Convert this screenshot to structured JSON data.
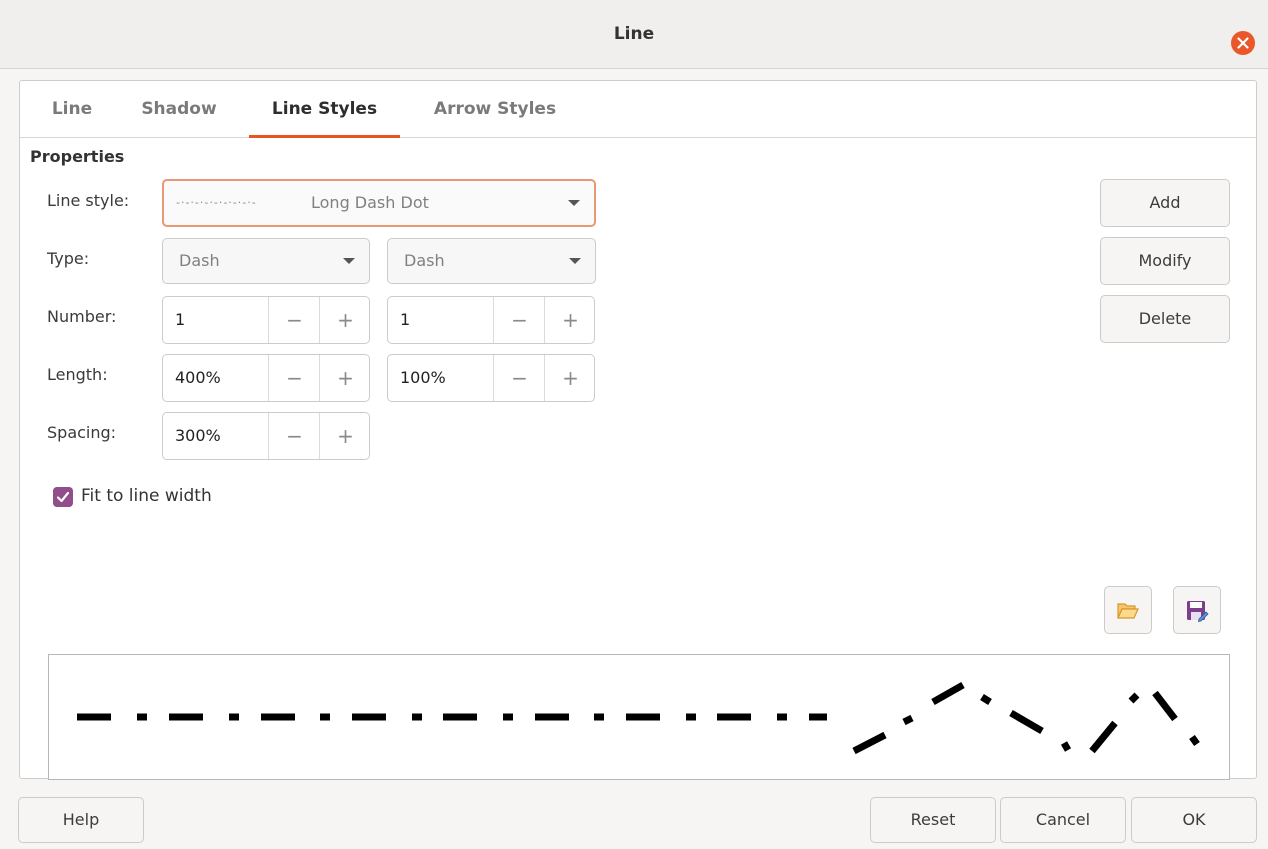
{
  "window": {
    "title": "Line"
  },
  "tabs": [
    {
      "label": "Line"
    },
    {
      "label": "Shadow"
    },
    {
      "label": "Line Styles"
    },
    {
      "label": "Arrow Styles"
    }
  ],
  "properties": {
    "heading": "Properties",
    "line_style_label": "Line style:",
    "line_style_sample": "-·-·-·-·-·-·-·-·-",
    "line_style_value": "Long Dash Dot",
    "type_label": "Type:",
    "type1": "Dash",
    "type2": "Dash",
    "number_label": "Number:",
    "number1": "1",
    "number2": "1",
    "length_label": "Length:",
    "length1": "400%",
    "length2": "100%",
    "spacing_label": "Spacing:",
    "spacing": "300%",
    "fit_label": "Fit to line width",
    "fit_checked": true
  },
  "spin": {
    "minus": "−",
    "plus": "+"
  },
  "side_buttons": {
    "add": "Add",
    "modify": "Modify",
    "delete": "Delete"
  },
  "bottom_buttons": {
    "help": "Help",
    "reset": "Reset",
    "cancel": "Cancel",
    "ok": "OK"
  },
  "icons": {
    "close": "close-icon",
    "load": "open-folder-icon",
    "save": "save-icon"
  },
  "colors": {
    "accent": "#e95420",
    "checkbox": "#924d8b",
    "close": "#e9572a"
  }
}
